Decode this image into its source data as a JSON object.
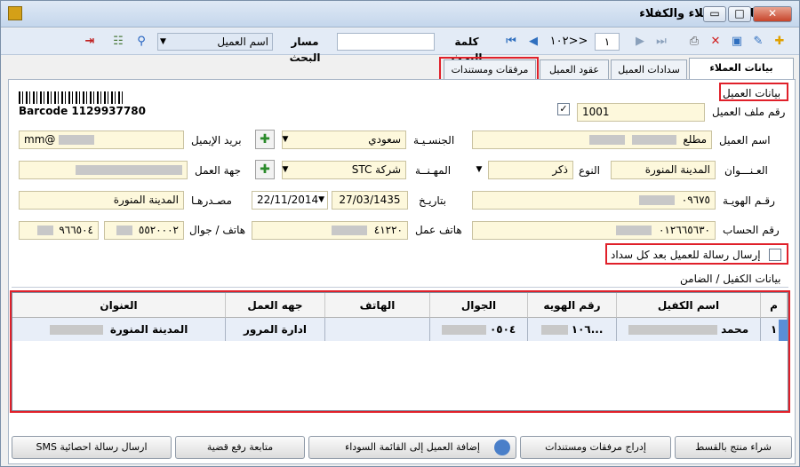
{
  "window": {
    "title": "بيانات العملاء والكفلاء",
    "minimize": "▭",
    "maximize": "□",
    "close": "✕"
  },
  "toolbar": {
    "record_position": "١٠٢>>",
    "record_number": "١",
    "search_keyword_label": "كلمة البحث",
    "search_path_label": "مسار البحث",
    "search_path_value": "اسم العميل",
    "icons": [
      "add-icon",
      "edit-icon",
      "save-icon",
      "delete-icon",
      "print-icon",
      "last-icon",
      "next-icon",
      "prev-icon",
      "first-icon",
      "search-icon",
      "filter-icon",
      "exit-icon"
    ]
  },
  "tabs": [
    {
      "label": "بيانات العملاء والكفلاء",
      "active": true
    },
    {
      "label": "سدادات العميل",
      "active": false
    },
    {
      "label": "عقود العميل",
      "active": false
    },
    {
      "label": "مرفقات ومستندات",
      "active": false
    }
  ],
  "form": {
    "section_title": "بيانات العميل",
    "barcode_text": "Barcode 1129937780",
    "file_no_label": "رقم ملف العميل",
    "file_no_value": "1001",
    "name_label": "اسم العميل",
    "name_value": "مطلع",
    "nationality_label": "الجنسـيـة",
    "nationality_value": "سعودي",
    "email_label": "بريد الإيميل",
    "email_value": "mm@",
    "address_label": "العـنـــوان",
    "address_value": "المدينة المنورة",
    "gender_label": "النوع",
    "gender_value": "ذكر",
    "job_label": "المهـنــة",
    "job_value": "شركة STC",
    "employer_label": "جهة العمل",
    "id_label": "رقـم الهويـة",
    "id_value": "٠٩٦٧٥",
    "date_label": "بتاريـخ",
    "date_hijri": "27/03/1435",
    "date_greg": "22/11/2014",
    "issue_label": "مصـدرهـا",
    "issue_value": "المدينة المنورة",
    "account_label": "رقم الحساب",
    "account_value": "٠١٢٦٦٥٦٣٠",
    "work_phone_label": "هاتف عمل",
    "work_phone_value": "٤١٢٢٠",
    "phone_label": "هاتف / جوال",
    "phone_value": "٥٥٢٠٠٠٢",
    "mobile_value": "٩٦٦٥٠٤",
    "sms_checkbox_label": "إرسال رسالة للعميل بعد كل سداد"
  },
  "guarantor": {
    "section_title": "بيانات الكفيل / الضامن",
    "columns": [
      "م",
      "اسم الكفيل",
      "رقم الهويه",
      "الجوال",
      "الهاتف",
      "جهه العمل",
      "العنوان"
    ],
    "rows": [
      {
        "index": "١",
        "name": "محمد",
        "id": "...١٠٦",
        "mobile": "٠٥٠٤",
        "phone": "",
        "employer": "ادارة المرور",
        "address": "المدينة المنورة"
      }
    ]
  },
  "buttons": {
    "buy_installment": "شراء منتج بالقسط",
    "insert_attachments": "إدراج مرفقات ومستندات",
    "blacklist": "إضافة العميل إلى القائمة السوداء",
    "case_followup": "متابعة رفع قضية",
    "sms_stats": "ارسال رسالة احصائية SMS"
  }
}
